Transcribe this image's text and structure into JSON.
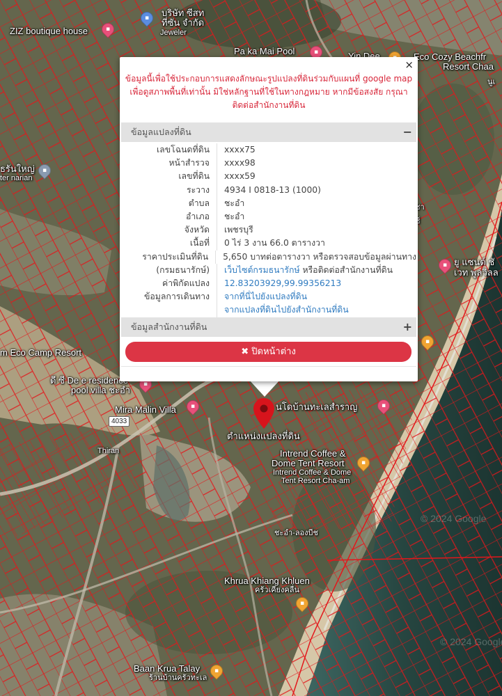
{
  "map": {
    "labels": {
      "ziz": "ZIZ boutique house",
      "company_line1": "บริษัท ซีสท",
      "company_line2": "ที่ซัน จำกัด",
      "jeweler": "Jeweler",
      "pakamai": "Pa ka Mai Pool",
      "yindee": "Yin Dee",
      "ecocozy_line1": "Eco Cozy Beachfr",
      "ecocozy_line2": "Resort Chaa",
      "ecocamp": "m Eco Camp Resort",
      "de_res": "ดี ซี De e residence",
      "pool_villa": "pool villa ชะอำ",
      "mira": "Mira Malin Villa",
      "tahasaraen": "นโดบ้านทะเลสำราญ",
      "parcel_pos": "ตำแหน่งแปลงที่ดิน",
      "intrend_line1": "Intrend Coffee &",
      "intrend_line2": "Dome Tent Resort",
      "intrend_small1": "Intrend Coffee & Dome",
      "intrend_small2": "Tent Resort Cha-am",
      "chaam_sam": "ชะอำ-ลองบีช",
      "khrua_line1": "Khrua Khiang Khluen",
      "khrua_line2": "ครัวเคียงคลื่น",
      "baan_line1": "Baan Krua Talay",
      "baan_line2": "ร้านบ้านครัวทะเล",
      "narian_line1": "ธรันใหญ่",
      "narian_line2": "ter narian",
      "sand_line1": "ยู แซนด์ ชั",
      "sand_line2": "เวท พูลวิลล",
      "road_thiran": "Thiran",
      "right_edge1": "นูเ",
      "right_edge2": "ชา",
      "right_edge3": "ช์"
    },
    "road_shield": "4033",
    "watermark": "© 2024 Google"
  },
  "popup": {
    "close_symbol": "×",
    "notice": "ข้อมูลนี้เพื่อใช้ประกอบการแสดงลักษณะรูปแปลงที่ดินร่วมกับแผนที่ google map เพื่อดูสภาพพื้นที่เท่านั้น มิใช่หลักฐานที่ใช้ในทางกฎหมาย หากมีข้อสงสัย กรุณาติดต่อสำนักงานที่ดิน",
    "panel1_title": "ข้อมูลแปลงที่ดิน",
    "panel1_toggle": "−",
    "panel2_title": "ข้อมูลสำนักงานที่ดิน",
    "panel2_toggle": "+",
    "rows": [
      {
        "key": "เลขโฉนดที่ดิน",
        "value": "xxxx75"
      },
      {
        "key": "หน้าสำรวจ",
        "value": "xxxx98"
      },
      {
        "key": "เลขที่ดิน",
        "value": "xxxx59"
      },
      {
        "key": "ระวาง",
        "value": "4934 I 0818-13 (1000)"
      },
      {
        "key": "ตำบล",
        "value": "ชะอำ"
      },
      {
        "key": "อำเภอ",
        "value": "ชะอำ"
      },
      {
        "key": "จังหวัด",
        "value": "เพชรบุรี"
      },
      {
        "key": "เนื้อที่",
        "value": "0 ไร่ 3 งาน 66.0 ตารางวา"
      },
      {
        "key": "ราคาประเมินที่ดิน",
        "value": "5,650 บาทต่อตารางวา หรือตรวจสอบข้อมูลผ่านทาง"
      },
      {
        "key": "(กรมธนารักษ์)",
        "value": "เว็บไซต์กรมธนารักษ์",
        "value2": " หรือติดต่อสำนักงานที่ดิน"
      },
      {
        "key": "ค่าพิกัดแปลง",
        "value": "12.83203929,99.99356213"
      },
      {
        "key": "ข้อมูลการเดินทาง",
        "value": "จากที่นี่ไปยังแปลงที่ดิน"
      },
      {
        "key": "",
        "value": "จากแปลงที่ดินไปยังสำนักงานที่ดิน"
      }
    ],
    "close_button_icon": "✖",
    "close_button_label": "ปิดหน้าต่าง"
  },
  "colors": {
    "parcel_line": "#e3171b",
    "notice_text": "#d8273a",
    "link": "#2f7bc0",
    "close_button": "#dc3545",
    "sea": "#2c4a47"
  },
  "icons": {
    "marker": "map-pin-icon",
    "close": "close-icon",
    "collapse": "minus-icon",
    "expand": "plus-icon"
  }
}
